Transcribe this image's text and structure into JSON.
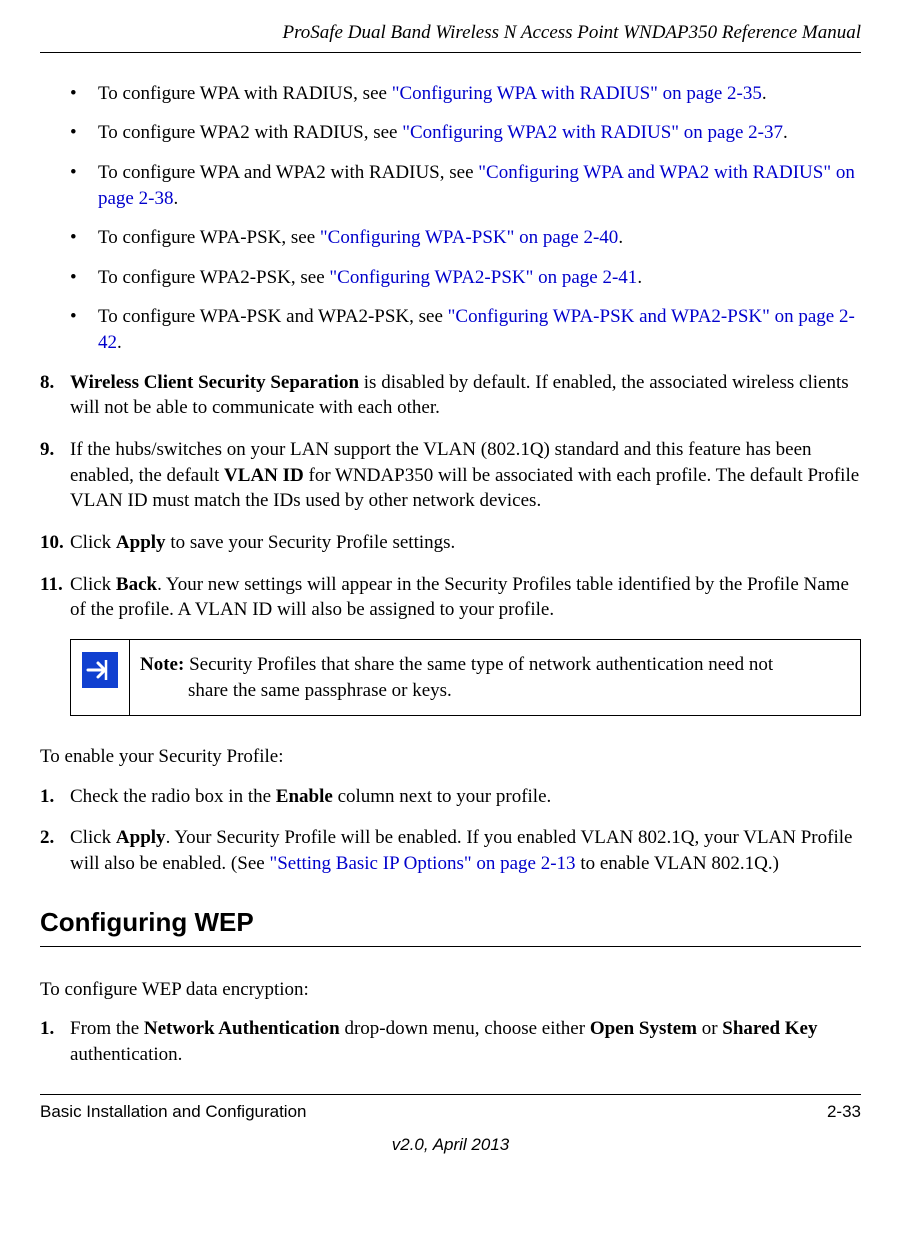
{
  "header": {
    "title": "ProSafe Dual Band Wireless N Access Point WNDAP350 Reference Manual"
  },
  "bullets": {
    "b1_pre": "To configure WPA with RADIUS, see ",
    "b1_link": "\"Configuring WPA with RADIUS\" on page 2-35",
    "b1_post": ".",
    "b2_pre": "To configure WPA2 with RADIUS, see ",
    "b2_link": "\"Configuring WPA2 with RADIUS\" on page 2-37",
    "b2_post": ".",
    "b3_pre": "To configure WPA and WPA2 with RADIUS, see ",
    "b3_link": "\"Configuring WPA and WPA2 with RADIUS\" on page 2-38",
    "b3_post": ".",
    "b4_pre": "To configure WPA-PSK, see ",
    "b4_link": "\"Configuring WPA-PSK\" on page 2-40",
    "b4_post": ".",
    "b5_pre": "To configure WPA2-PSK, see ",
    "b5_link": "\"Configuring WPA2-PSK\" on page 2-41",
    "b5_post": ".",
    "b6_pre": "To configure WPA-PSK and WPA2-PSK, see ",
    "b6_link": "\"Configuring WPA-PSK and WPA2-PSK\" on page 2-42",
    "b6_post": "."
  },
  "steps": {
    "s8_num": "8.",
    "s8_bold": "Wireless Client Security Separation",
    "s8_rest": " is disabled by default. If enabled, the associated wireless clients will not be able to communicate with each other.",
    "s9_num": "9.",
    "s9_pre": "If the hubs/switches on your LAN support the VLAN (802.1Q) standard and this feature has been enabled, the default ",
    "s9_bold": "VLAN ID",
    "s9_post": " for WNDAP350 will be associated with each profile. The default Profile VLAN ID must match the IDs used by other network devices.",
    "s10_num": "10.",
    "s10_pre": "Click ",
    "s10_bold": "Apply",
    "s10_post": " to save your Security Profile settings.",
    "s11_num": "11.",
    "s11_pre": "Click ",
    "s11_bold": "Back",
    "s11_post": ". Your new settings will appear in the Security Profiles table identified by the Profile Name of the profile. A VLAN ID will also be assigned to your profile."
  },
  "note": {
    "label": "Note:",
    "text_line1": " Security Profiles that share the same type of network authentication need not",
    "text_line2": "share the same passphrase or keys."
  },
  "enable": {
    "intro": "To enable your Security Profile:",
    "e1_num": "1.",
    "e1_pre": "Check the radio box in the ",
    "e1_bold": "Enable",
    "e1_post": " column next to your profile.",
    "e2_num": "2.",
    "e2_pre": "Click ",
    "e2_bold": "Apply",
    "e2_mid": ". Your Security Profile will be enabled. If you enabled VLAN 802.1Q, your VLAN Profile will also be enabled. (See ",
    "e2_link": "\"Setting Basic IP Options\" on page 2-13",
    "e2_post": " to enable VLAN 802.1Q.)"
  },
  "section": {
    "heading": "Configuring WEP",
    "intro": "To configure WEP data encryption:",
    "w1_num": "1.",
    "w1_pre": "From the ",
    "w1_bold1": "Network Authentication",
    "w1_mid": " drop-down menu, choose either ",
    "w1_bold2": "Open System",
    "w1_or": " or ",
    "w1_bold3": "Shared Key",
    "w1_post": " authentication."
  },
  "footer": {
    "left": "Basic Installation and Configuration",
    "right": "2-33",
    "version": "v2.0, April 2013"
  }
}
